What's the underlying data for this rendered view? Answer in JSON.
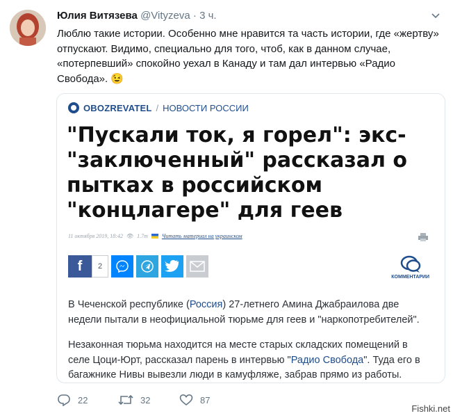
{
  "tweet": {
    "author_name": "Юлия Витязева",
    "author_handle": "@Vityzeva",
    "separator": "·",
    "time": "3 ч.",
    "text": "Люблю такие истории. Особенно мне нравится та часть истории, где «жертву» отпускают. Видимо, специально для того, чтоб, как в данном случае, «потерпевший» спокойно уехал в Канаду и там дал интервью «Радио Свобода».",
    "emoji": "😉"
  },
  "card": {
    "brand_name": "OBOZREVATEL",
    "brand_separator": "/",
    "brand_section": "НОВОСТИ РОССИИ",
    "headline": "\"Пускали ток, я горел\": экс-\"заключенный\" рассказал о пытках в российском \"концлагере\" для геев",
    "date": "11 октября 2019, 18:42",
    "views": "1.7т",
    "ua_link": "Читать материал на украинском",
    "fb_count": "2",
    "comments_label": "КОММЕНТАРИИ",
    "para1_before": "В Чеченской республике (",
    "para1_link": "Россия",
    "para1_after": ") 27-летнего Амина Джабраилова две недели пытали в неофициальной тюрьме для геев и \"наркопотребителей\".",
    "para2_before": "Незаконная тюрьма находится на месте старых складских помещений в селе Цоци-Юрт, рассказал парень в интервью \"",
    "para2_link": "Радио Свобода",
    "para2_after": "\". Туда его в багажнике Нивы вывезли люди в камуфляже, забрав прямо из работы."
  },
  "actions": {
    "replies": "22",
    "retweets": "32",
    "likes": "87"
  },
  "watermark": "Fishki.net",
  "colors": {
    "brand": "#1f4d8b",
    "facebook": "#3b5998",
    "messenger": "#0084ff",
    "telegram": "#2ca5e0",
    "twitter": "#1da1f2"
  }
}
